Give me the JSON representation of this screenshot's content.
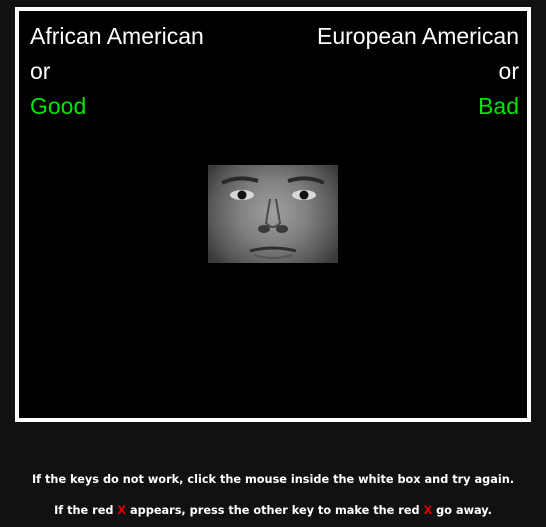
{
  "task": {
    "left_category_top": "African American",
    "right_category_top": "European American",
    "left_or": "or",
    "right_or": "or",
    "left_category_bottom": "Good",
    "right_category_bottom": "Bad",
    "accent_green": "#00e600"
  },
  "stimulus": {
    "icon": "face-photo-icon"
  },
  "instructions": {
    "line1": "If the keys do not work, click the mouse inside the white box and try again.",
    "line2_part1": "If the red ",
    "line2_x1": "X",
    "line2_part2": " appears, press the other key to make the red ",
    "line2_x2": "X",
    "line2_part3": " go away.",
    "error_color": "#e00000"
  }
}
